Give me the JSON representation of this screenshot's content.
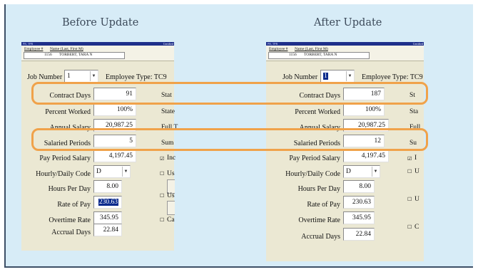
{
  "headings": {
    "before": "Before Update",
    "after": "After Update"
  },
  "screen": {
    "titlebar_left": "PR, TPR",
    "titlebar_right": "Certified",
    "employee_label": "Employee #",
    "name_label": "Name (Last, First M)",
    "employee_num": "1156",
    "employee_name": "TORBERT, TARA N",
    "job_number_label": "Job Number",
    "employee_type_label": "Employee Type:",
    "employee_type": "TC9",
    "labels": {
      "contract_days": "Contract Days",
      "percent_worked": "Percent Worked",
      "annual_salary": "Annual Salary",
      "salaried_periods": "Salaried Periods",
      "pay_period_salary": "Pay Period Salary",
      "hourly_daily_code": "Hourly/Daily Code",
      "hours_per_day": "Hours Per Day",
      "rate_of_pay": "Rate of Pay",
      "overtime_rate": "Overtime Rate",
      "accrual_days": "Accrual Days"
    }
  },
  "before": {
    "job_number": "1",
    "contract_days": "91",
    "percent_worked": "100%",
    "annual_salary": "20,987.25",
    "salaried_periods": "5",
    "pay_period_salary": "4,197.45",
    "hourly_daily_code": "D",
    "hours_per_day": "8.00",
    "rate_of_pay": "230.63",
    "overtime_rate": "345.95",
    "accrual_days": "22.84",
    "side": {
      "stat": "Stat",
      "state": "State",
      "full": "Full T",
      "sum": "Sum",
      "inc": "Inc",
      "us1": "Us",
      "us2": "Us",
      "ca": "Ca"
    }
  },
  "after": {
    "job_number": "1",
    "contract_days": "187",
    "percent_worked": "100%",
    "annual_salary": "20,987.25",
    "salaried_periods": "12",
    "pay_period_salary": "4,197.45",
    "hourly_daily_code": "D",
    "hours_per_day": "8.00",
    "rate_of_pay": "230.63",
    "overtime_rate": "345.95",
    "accrual_days": "22.84",
    "side": {
      "stat": "St",
      "state": "Sta",
      "full": "Full",
      "sum": "Su",
      "inc": "I",
      "us1": "U",
      "us2": "U",
      "ca": "C"
    }
  },
  "colors": {
    "highlight": "#f0a24a",
    "selection": "#0a2a8c",
    "panel": "#ebe8d3",
    "background": "#d7ecf7"
  }
}
